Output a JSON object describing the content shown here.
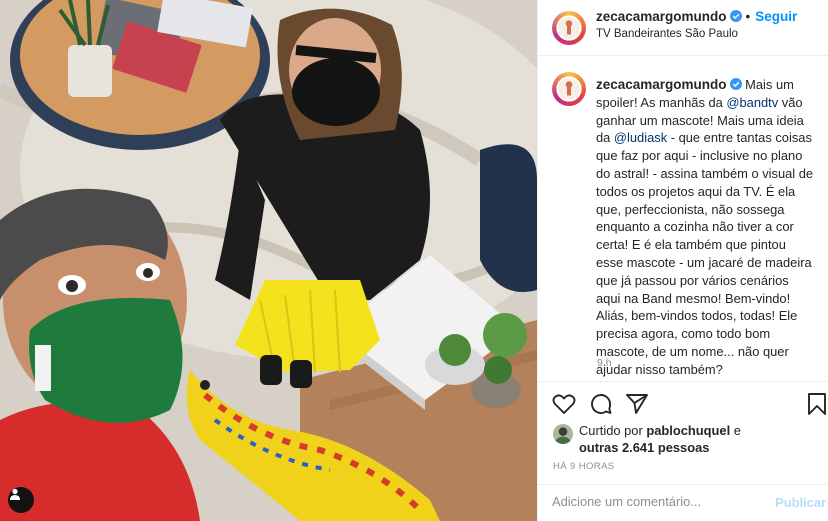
{
  "post": {
    "username": "zecacamargomundo",
    "separator": "•",
    "follow_label": "Seguir",
    "location": "TV Bandeirantes São Paulo",
    "caption": {
      "part1": "Mais um spoiler! As manhãs da ",
      "mention1": "@bandtv",
      "part2": " vão ganhar um mascote! Mais uma ideia da ",
      "mention2": "@ludiask",
      "part3": " - que entre tantas coisas que faz por aqui - inclusive no plano do astral! - assina também o visual de todos os projetos aqui da TV. É ela que, perfeccionista, não sossega enquanto a cozinha não tiver a cor certa! E é ela também que pintou esse mascote - um jacaré de madeira que já passou por vários cenários aqui na Band mesmo! Bem-vindo! Aliás, bem-vindos todos, todas! Ele precisa agora, como todo bom mascote, de um nome... não quer ajudar nisso também?"
    },
    "caption_time": "9 h",
    "likes": {
      "prefix": "Curtido por",
      "user": "pablochuquel",
      "conj": "e",
      "others": "outras 2.641 pessoas"
    },
    "posted_ago": "HÁ 9 HORAS",
    "comment_placeholder": "Adicione um comentário...",
    "publish_label": "Publicar"
  },
  "icons": {
    "verified": "verified-badge-icon",
    "like": "heart-icon",
    "comment": "comment-bubble-icon",
    "share": "paper-plane-icon",
    "save": "bookmark-icon",
    "tags": "user-tag-icon"
  },
  "colors": {
    "accent": "#0095f6",
    "mention": "#00376b",
    "muted": "#8e8e8e",
    "publish_disabled": "#b2dffc"
  }
}
